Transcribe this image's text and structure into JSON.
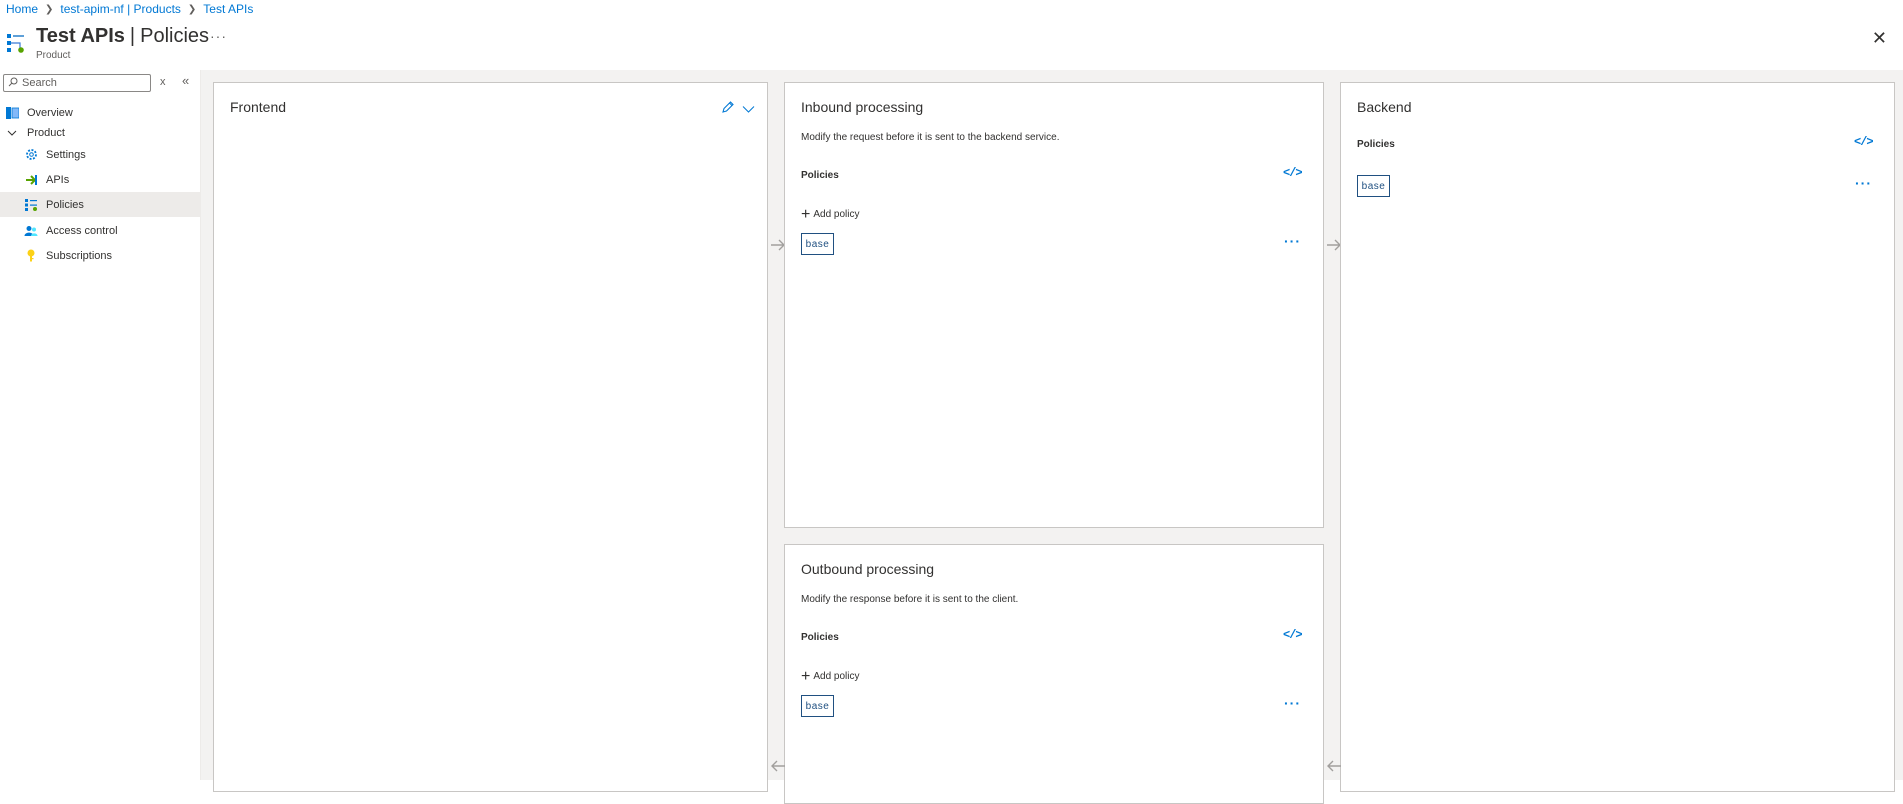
{
  "breadcrumb": {
    "items": [
      "Home",
      "test-apim-nf | Products",
      "Test APIs"
    ],
    "separator": ">"
  },
  "header": {
    "title_main": "Test APIs",
    "title_separator": "|",
    "title_page": "Policies",
    "subtitle": "Product",
    "more_label": "···",
    "close_label": "✕"
  },
  "sidebar": {
    "search_placeholder": "Search",
    "clear_label": "x",
    "collapse_label": "«",
    "items": [
      {
        "label": "Overview",
        "icon": "overview-icon"
      },
      {
        "label": "Product",
        "icon": "chevron-down-icon",
        "group": true
      },
      {
        "label": "Settings",
        "icon": "gear-icon"
      },
      {
        "label": "APIs",
        "icon": "api-arrow-icon"
      },
      {
        "label": "Policies",
        "icon": "policies-icon",
        "active": true
      },
      {
        "label": "Access control",
        "icon": "people-icon"
      },
      {
        "label": "Subscriptions",
        "icon": "key-icon"
      }
    ]
  },
  "frontend": {
    "title": "Frontend"
  },
  "inbound": {
    "title": "Inbound processing",
    "description": "Modify the request before it is sent to the backend service.",
    "policies_label": "Policies",
    "code_label": "</>",
    "add_policy_label": "Add policy",
    "base_label": "base",
    "more_label": "···"
  },
  "outbound": {
    "title": "Outbound processing",
    "description": "Modify the response before it is sent to the client.",
    "policies_label": "Policies",
    "code_label": "</>",
    "add_policy_label": "Add policy",
    "base_label": "base",
    "more_label": "···"
  },
  "backend": {
    "title": "Backend",
    "policies_label": "Policies",
    "code_label": "</>",
    "base_label": "base",
    "more_label": "···"
  },
  "colors": {
    "accent": "#0078d4",
    "active_nav": "#edebe9",
    "canvas_bg": "#f3f2f1",
    "base_border": "#205081"
  }
}
